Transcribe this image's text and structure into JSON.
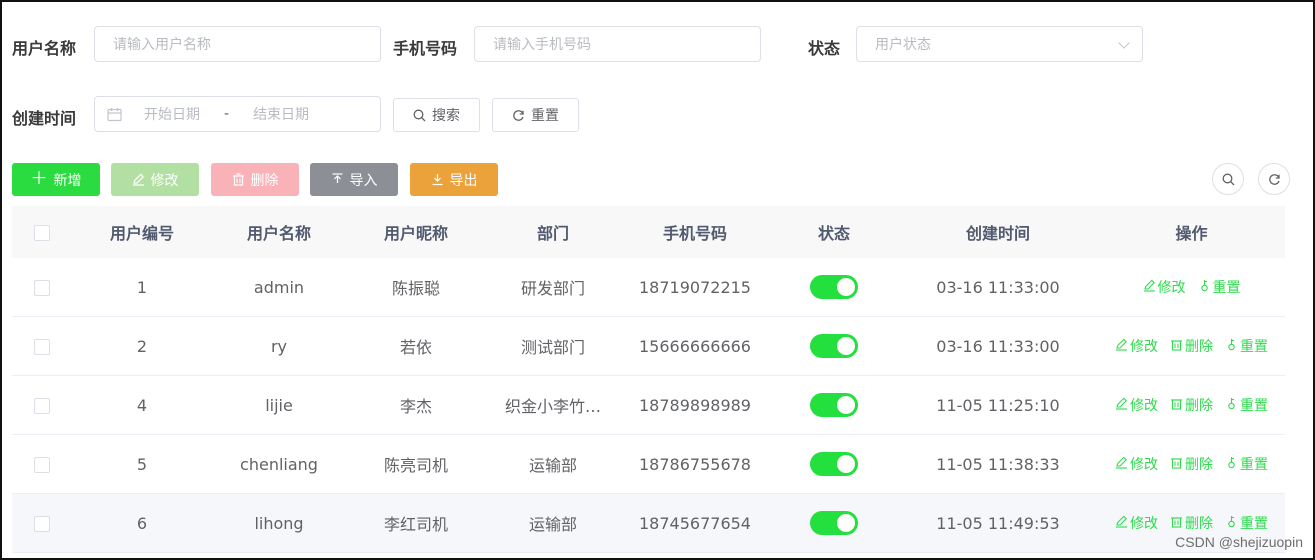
{
  "search": {
    "username_label": "用户名称",
    "username_placeholder": "请输入用户名称",
    "phone_label": "手机号码",
    "phone_placeholder": "请输入手机号码",
    "status_label": "状态",
    "status_placeholder": "用户状态",
    "created_label": "创建时间",
    "start_date_placeholder": "开始日期",
    "date_separator": "-",
    "end_date_placeholder": "结束日期",
    "search_button": "搜索",
    "reset_button": "重置"
  },
  "toolbar": {
    "add": "新增",
    "edit": "修改",
    "delete": "删除",
    "import": "导入",
    "export": "导出"
  },
  "colors": {
    "add": "#2bdc41",
    "edit": "#b2e0a2",
    "delete": "#f9b3b8",
    "import": "#8c8f96",
    "export": "#eca23a",
    "switch_on": "#24e03f",
    "action_text": "#2fdb4f"
  },
  "table": {
    "headers": [
      "用户编号",
      "用户名称",
      "用户昵称",
      "部门",
      "手机号码",
      "状态",
      "创建时间",
      "操作"
    ],
    "actions": {
      "edit": "修改",
      "delete": "删除",
      "reset": "重置"
    },
    "rows": [
      {
        "id": "1",
        "username": "admin",
        "nickname": "陈振聪",
        "dept": "研发部门",
        "phone": "18719072215",
        "status_on": true,
        "created": "03-16 11:33:00"
      },
      {
        "id": "2",
        "username": "ry",
        "nickname": "若依",
        "dept": "测试部门",
        "phone": "15666666666",
        "status_on": true,
        "created": "03-16 11:33:00"
      },
      {
        "id": "4",
        "username": "lijie",
        "nickname": "李杰",
        "dept": "织金小李竹…",
        "phone": "18789898989",
        "status_on": true,
        "created": "11-05 11:25:10"
      },
      {
        "id": "5",
        "username": "chenliang",
        "nickname": "陈亮司机",
        "dept": "运输部",
        "phone": "18786755678",
        "status_on": true,
        "created": "11-05 11:38:33"
      },
      {
        "id": "6",
        "username": "lihong",
        "nickname": "李红司机",
        "dept": "运输部",
        "phone": "18745677654",
        "status_on": true,
        "created": "11-05 11:49:53"
      }
    ]
  },
  "watermark": "CSDN @shejizuopin"
}
